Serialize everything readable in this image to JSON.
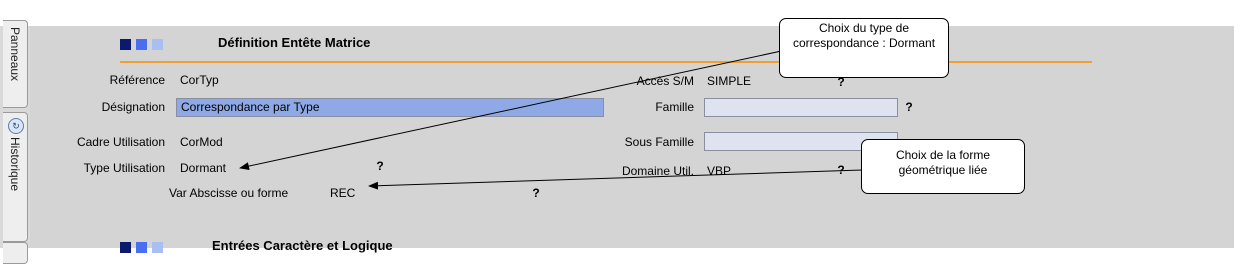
{
  "side_tabs": {
    "panneaux": "Panneaux",
    "historique": "Historique"
  },
  "section1_title": "Définition Entête Matrice",
  "section2_title": "Entrées Caractère et Logique",
  "fields": {
    "reference": {
      "label": "Référence",
      "value": "CorTyp"
    },
    "designation": {
      "label": "Désignation",
      "value": "Correspondance par Type"
    },
    "cadre": {
      "label": "Cadre Utilisation",
      "value": "CorMod"
    },
    "type": {
      "label": "Type Utilisation",
      "value": "Dormant"
    },
    "var": {
      "label": "Var Abscisse ou forme",
      "value": "REC"
    },
    "acces": {
      "label": "Accès S/M",
      "value": "SIMPLE"
    },
    "famille": {
      "label": "Famille"
    },
    "sous_famille": {
      "label": "Sous Famille"
    },
    "domaine": {
      "label": "Domaine Util.",
      "value": "VBP"
    }
  },
  "help_mark": "?",
  "callouts": {
    "type": "Choix du type de correspondance : Dormant",
    "forme": "Choix de la forme géométrique liée"
  },
  "colors": {
    "accent_line": "#f0a030",
    "selection": "#8ea9e6",
    "square_dark": "#0c1a6e",
    "square_mid": "#4a6ef0",
    "square_light": "#a9bff2"
  }
}
